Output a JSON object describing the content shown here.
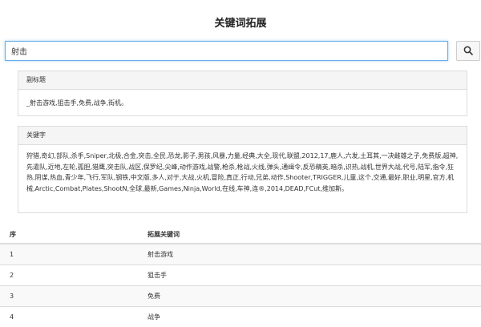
{
  "page": {
    "title": "关键词拓展"
  },
  "search": {
    "value": "射击",
    "button_icon": "search-icon"
  },
  "subtitle_panel": {
    "heading": "副标题",
    "body": "_射击游戏,狙击手,免费,战争,街机。"
  },
  "keywords_panel": {
    "heading": "关键字",
    "body": "狩猎,奇幻,部队,杀手,Sniper,北极,合金,突击,全民,恐龙,影子,男孩,风暴,力量,经典,大全,现代,联盟,2012,17,鹿人,六发,土耳其,一决雌雄之子,免费版,超神,先遣队,近地,左轮,孤胆,猎鹰,突击队,战区,保罗纪,尖峰,动作游戏,战警,枪杀,枪战,火线,弹头,通缉令,反恐精英,暗杀,识热,战机,世界大战,代号,陆军,指令,狂热,阴谋,热血,青少年,飞行,军队,钢铁,中文版,多人,对于,大战,火机,冒险,真正,行动,兄弟,动作,Shooter,TRIGGER,儿童,这个,交通,最好,职业,明星,官方,机械,Arctic,Combat,Plates,ShootN,全球,最新,Games,Ninja,World,在线,车神,连®,2014,DEAD,FCut,维加斯。"
  },
  "table": {
    "headers": {
      "index": "序",
      "keyword": "拓展关键词"
    },
    "rows": [
      {
        "index": "1",
        "keyword": "射击游戏"
      },
      {
        "index": "2",
        "keyword": "狙击手"
      },
      {
        "index": "3",
        "keyword": "免费"
      },
      {
        "index": "4",
        "keyword": "战争"
      }
    ]
  }
}
